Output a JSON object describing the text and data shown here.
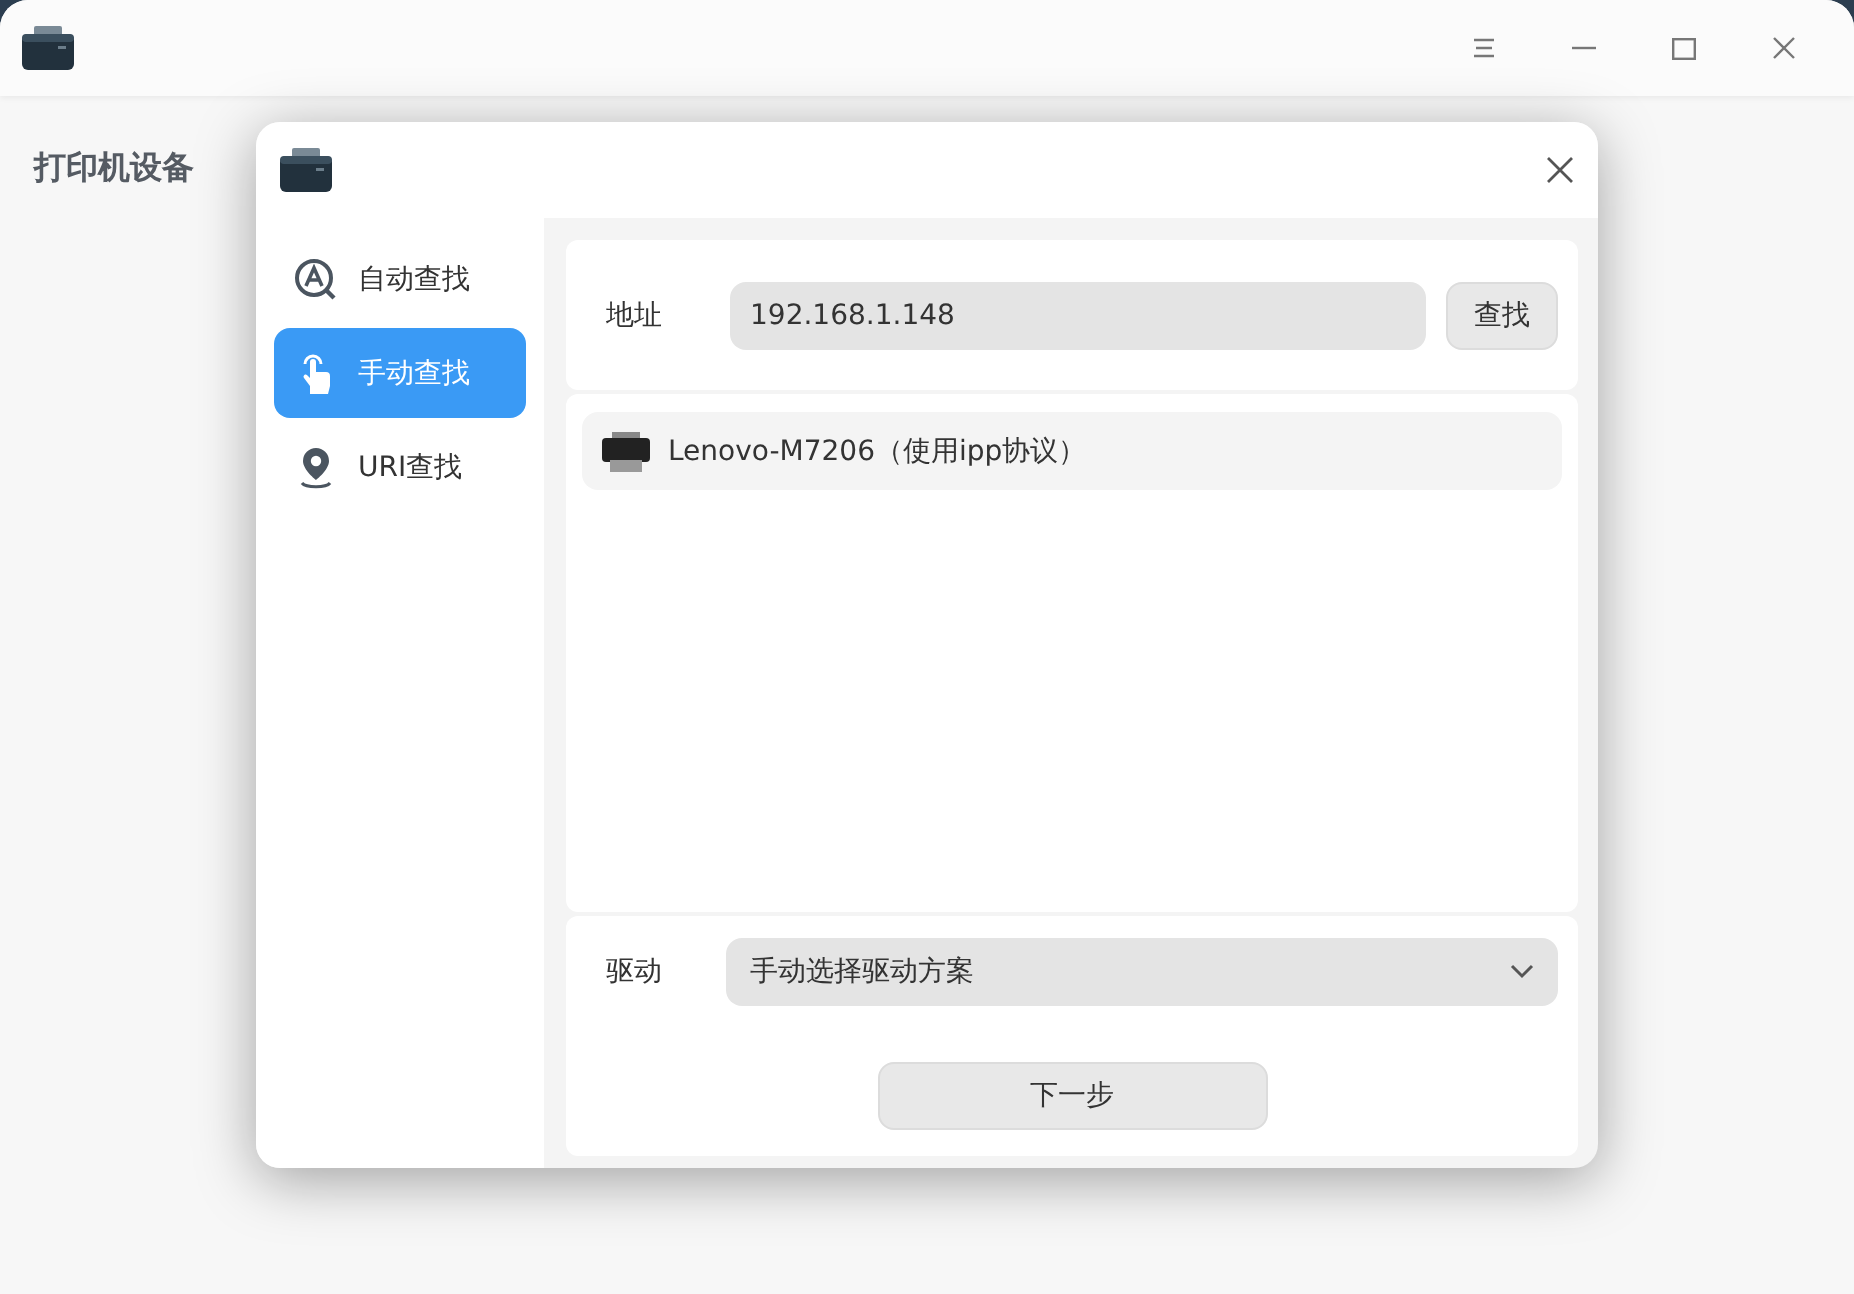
{
  "main_window": {
    "heading": "打印机设备"
  },
  "dialog": {
    "nav": [
      {
        "label": "自动查找",
        "kind": "auto",
        "selected": false
      },
      {
        "label": "手动查找",
        "kind": "manual",
        "selected": true
      },
      {
        "label": "URI查找",
        "kind": "uri",
        "selected": false
      }
    ],
    "address": {
      "label": "地址",
      "value": "192.168.1.148"
    },
    "search_button": "查找",
    "printers": [
      {
        "name": "Lenovo-M7206（使用ipp协议）"
      }
    ],
    "driver": {
      "label": "驱动",
      "value": "手动选择驱动方案"
    },
    "next_button": "下一步"
  }
}
